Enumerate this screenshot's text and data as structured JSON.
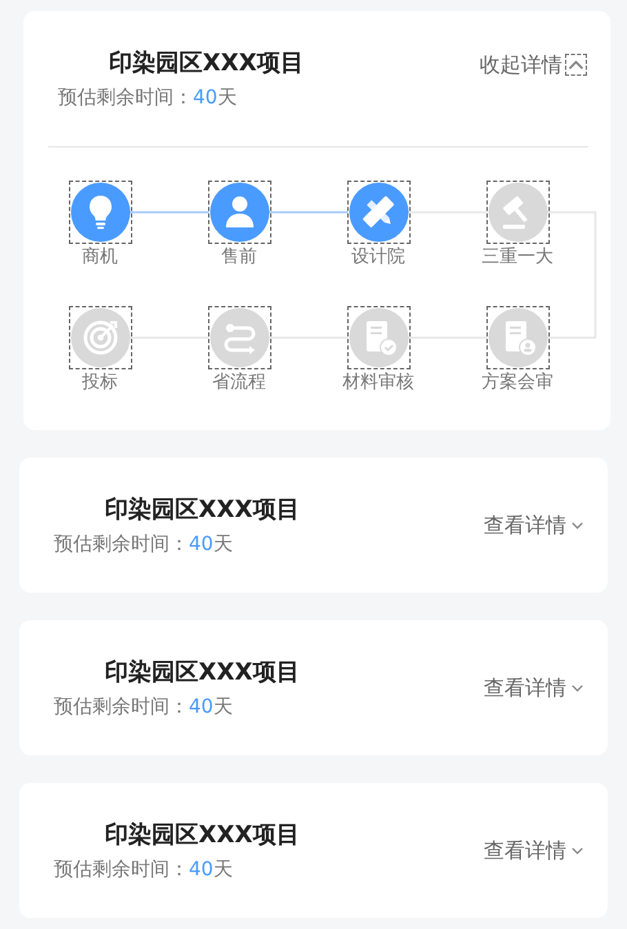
{
  "projects": [
    {
      "title": "印染园区XXX项目",
      "remaining_label": "预估剩余时间：",
      "remaining_value": "40",
      "remaining_unit": "天",
      "toggle_label": "收起详情",
      "expanded": true,
      "steps": [
        {
          "label": "商机",
          "kind": "bulb",
          "done": true
        },
        {
          "label": "售前",
          "kind": "person",
          "done": true
        },
        {
          "label": "设计院",
          "kind": "ruler",
          "done": true
        },
        {
          "label": "三重一大",
          "kind": "gavel",
          "done": false
        },
        {
          "label": "投标",
          "kind": "target",
          "done": false
        },
        {
          "label": "省流程",
          "kind": "flow",
          "done": false
        },
        {
          "label": "材料审核",
          "kind": "doccheck",
          "done": false
        },
        {
          "label": "方案会审",
          "kind": "docperson",
          "done": false
        }
      ]
    },
    {
      "title": "印染园区XXX项目",
      "remaining_label": "预估剩余时间：",
      "remaining_value": "40",
      "remaining_unit": "天",
      "toggle_label": "查看详情",
      "expanded": false
    },
    {
      "title": "印染园区XXX项目",
      "remaining_label": "预估剩余时间：",
      "remaining_value": "40",
      "remaining_unit": "天",
      "toggle_label": "查看详情",
      "expanded": false
    },
    {
      "title": "印染园区XXX项目",
      "remaining_label": "预估剩余时间：",
      "remaining_value": "40",
      "remaining_unit": "天",
      "toggle_label": "查看详情",
      "expanded": false
    }
  ]
}
